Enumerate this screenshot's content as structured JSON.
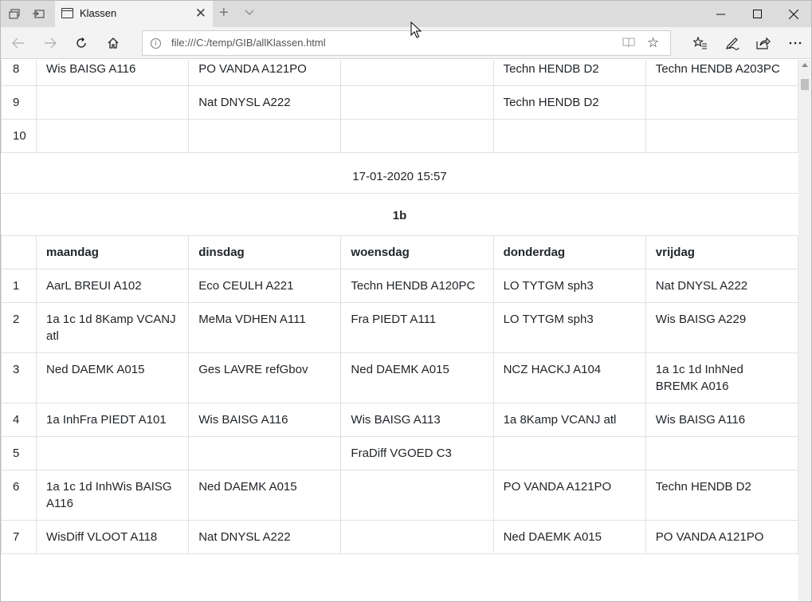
{
  "browser": {
    "tab_title": "Klassen",
    "url": "file:///C:/temp/GIB/allKlassen.html"
  },
  "top_rows": [
    {
      "num": "8",
      "cells": [
        "Wis BAISG A116",
        "PO VANDA A121PO",
        "",
        "Techn HENDB D2",
        "Techn HENDB A203PC"
      ]
    },
    {
      "num": "9",
      "cells": [
        "",
        "Nat DNYSL A222",
        "",
        "Techn HENDB D2",
        ""
      ]
    },
    {
      "num": "10",
      "cells": [
        "",
        "",
        "",
        "",
        ""
      ]
    }
  ],
  "timestamp": "17-01-2020 15:57",
  "klas": "1b",
  "days": [
    "maandag",
    "dinsdag",
    "woensdag",
    "donderdag",
    "vrijdag"
  ],
  "rows": [
    {
      "num": "1",
      "cells": [
        "AarL BREUI A102",
        "Eco CEULH A221",
        "Techn HENDB A120PC",
        "LO TYTGM sph3",
        "Nat DNYSL A222"
      ]
    },
    {
      "num": "2",
      "cells": [
        "1a 1c 1d 8Kamp VCANJ atl",
        "MeMa VDHEN A111",
        "Fra PIEDT A111",
        "LO TYTGM sph3",
        "Wis BAISG A229"
      ]
    },
    {
      "num": "3",
      "cells": [
        "Ned DAEMK A015",
        "Ges LAVRE refGbov",
        "Ned DAEMK A015",
        "NCZ HACKJ A104",
        "1a 1c 1d InhNed BREMK A016"
      ]
    },
    {
      "num": "4",
      "cells": [
        "1a InhFra PIEDT A101",
        "Wis BAISG A116",
        "Wis BAISG A113",
        "1a 8Kamp VCANJ atl",
        "Wis BAISG A116"
      ]
    },
    {
      "num": "5",
      "cells": [
        "",
        "",
        "FraDiff VGOED C3",
        "",
        ""
      ]
    },
    {
      "num": "6",
      "cells": [
        "1a 1c 1d InhWis BAISG A116",
        "Ned DAEMK A015",
        "",
        "PO VANDA A121PO",
        "Techn HENDB D2"
      ]
    },
    {
      "num": "7",
      "cells": [
        "WisDiff VLOOT A118",
        "Nat DNYSL A222",
        "",
        "Ned DAEMK A015",
        "PO VANDA A121PO"
      ]
    }
  ]
}
